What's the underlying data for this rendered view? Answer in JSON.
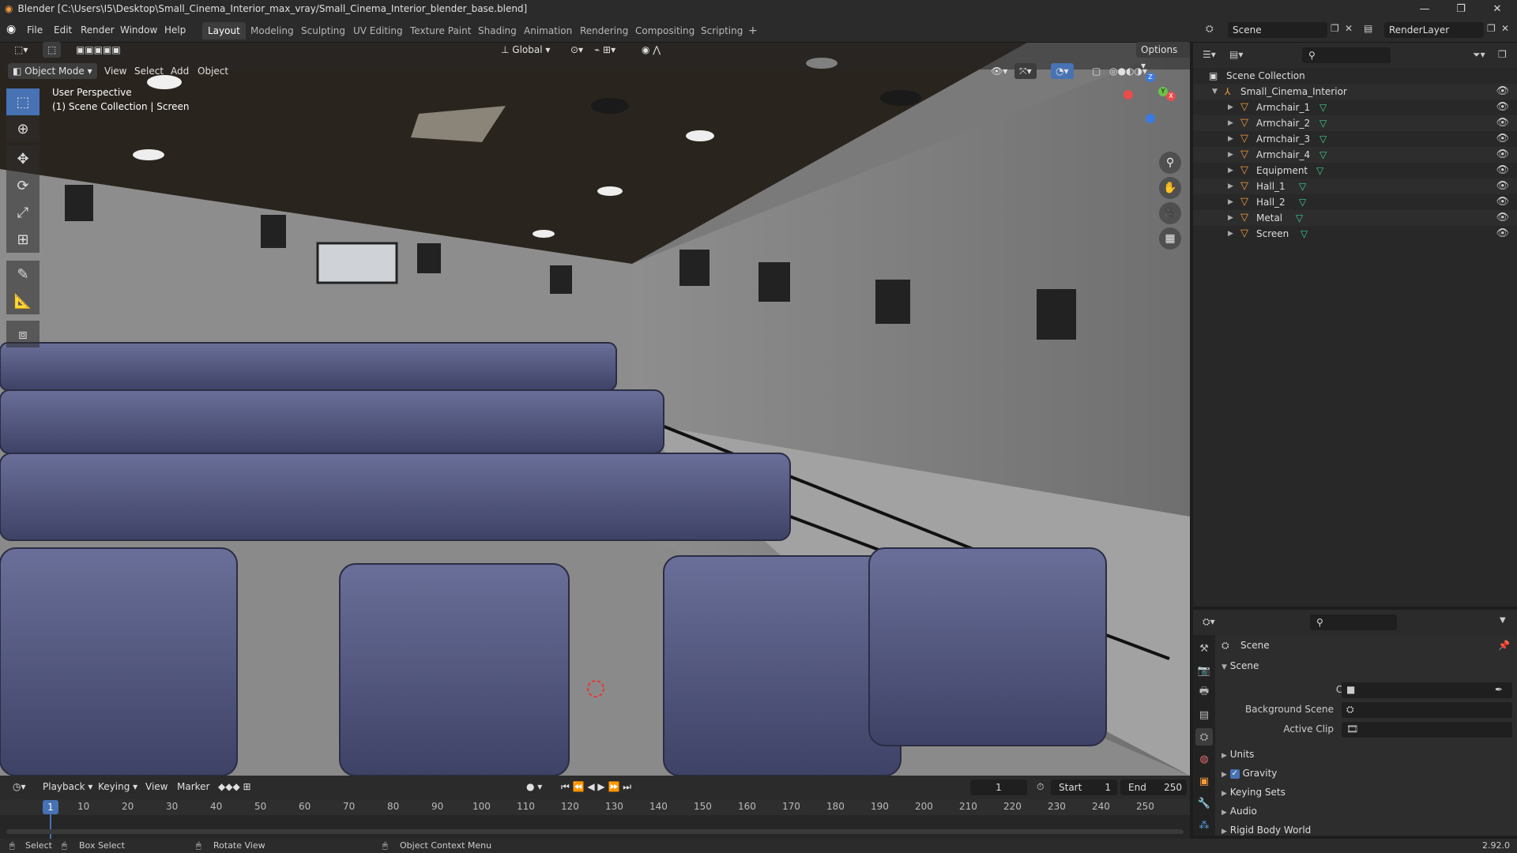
{
  "window": {
    "title": "Blender [C:\\Users\\I5\\Desktop\\Small_Cinema_Interior_max_vray/Small_Cinema_Interior_blender_base.blend]"
  },
  "menu": [
    "File",
    "Edit",
    "Render",
    "Window",
    "Help"
  ],
  "workspaces": [
    "Layout",
    "Modeling",
    "Sculpting",
    "UV Editing",
    "Texture Paint",
    "Shading",
    "Animation",
    "Rendering",
    "Compositing",
    "Scripting"
  ],
  "scene_field": "Scene",
  "layer_field": "RenderLayer",
  "viewport": {
    "mode": "Object Mode",
    "menus": [
      "View",
      "Select",
      "Add",
      "Object"
    ],
    "transform": "Global",
    "options": "Options",
    "perspective": "User Perspective",
    "collection_info": "(1) Scene Collection | Screen"
  },
  "gizmo": {
    "x": "X",
    "y": "Y",
    "z": "Z"
  },
  "outliner": {
    "root": "Scene Collection",
    "collection": "Small_Cinema_Interior",
    "objects": [
      "Armchair_1",
      "Armchair_2",
      "Armchair_3",
      "Armchair_4",
      "Equipment",
      "Hall_1",
      "Hall_2",
      "Metal",
      "Screen"
    ]
  },
  "properties": {
    "title": "Scene",
    "panel": "Scene",
    "camera_label": "Camera",
    "bg_label": "Background Scene",
    "clip_label": "Active Clip",
    "panels": [
      "Units",
      "Gravity",
      "Keying Sets",
      "Audio",
      "Rigid Body World"
    ]
  },
  "timeline": {
    "menus": [
      "Playback",
      "Keying",
      "View",
      "Marker"
    ],
    "current_frame": "1",
    "start_label": "Start",
    "start": "1",
    "end_label": "End",
    "end": "250",
    "ticks": [
      "1",
      "10",
      "20",
      "30",
      "40",
      "50",
      "60",
      "70",
      "80",
      "90",
      "100",
      "110",
      "120",
      "130",
      "140",
      "150",
      "160",
      "170",
      "180",
      "190",
      "200",
      "210",
      "220",
      "230",
      "240",
      "250"
    ]
  },
  "status": {
    "select": "Select",
    "box_select": "Box Select",
    "rotate": "Rotate View",
    "context": "Object Context Menu",
    "version": "2.92.0"
  },
  "colors": {
    "accent": "#4772b3",
    "object": "#f29a3c",
    "mesh": "#3ecf8e",
    "header": "#2b2b2b"
  }
}
